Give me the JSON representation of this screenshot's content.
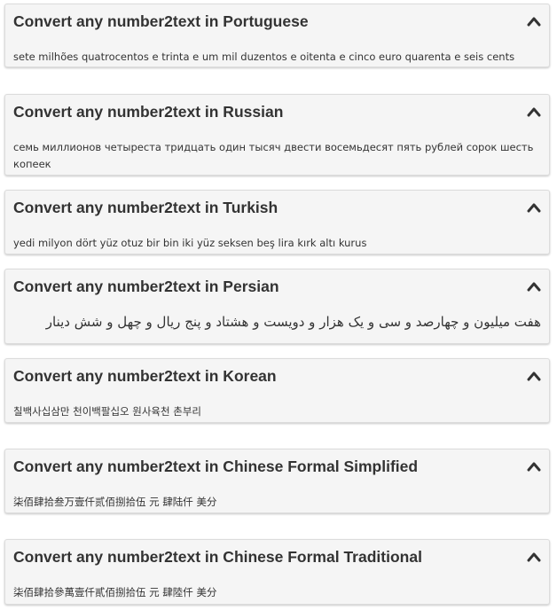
{
  "cards": [
    {
      "title": "Convert any number2text in Portuguese",
      "text": "sete milhões quatrocentos e trinta e um mil duzentos e oitenta e cinco euro quarenta e seis cents",
      "toggle_icon": "chevron-up-icon"
    },
    {
      "title": "Convert any number2text in Russian",
      "text": "семь миллионов четыреста тридцать один тысяч двести восемьдесят пять рублей сорок шесть копеек",
      "toggle_icon": "chevron-up-icon"
    },
    {
      "title": "Convert any number2text in Turkish",
      "text": "yedi milyon dört yüz otuz bir bin iki yüz seksen beş lira kırk altı kurus",
      "toggle_icon": "chevron-up-icon"
    },
    {
      "title": "Convert any number2text in Persian",
      "text": "هفت میلیون و چهارصد و سی و یک هزار و دویست و هشتاد و پنج ریال و چهل و شش دینار",
      "toggle_icon": "chevron-up-icon"
    },
    {
      "title": "Convert any number2text in Korean",
      "text": "칠백사십삼만 천이백팔십오 원사육천 촌부리",
      "toggle_icon": "chevron-up-icon"
    },
    {
      "title": "Convert any number2text in Chinese Formal Simplified",
      "text": "柒佰肆拾叁万壹仟贰佰捌拾伍 元 肆陆仟 美分",
      "toggle_icon": "chevron-up-icon"
    },
    {
      "title": "Convert any number2text in Chinese Formal Traditional",
      "text": "柒佰肆拾參萬壹仟貳佰捌拾伍 元 肆陸仟 美分",
      "toggle_icon": "chevron-up-icon"
    }
  ]
}
